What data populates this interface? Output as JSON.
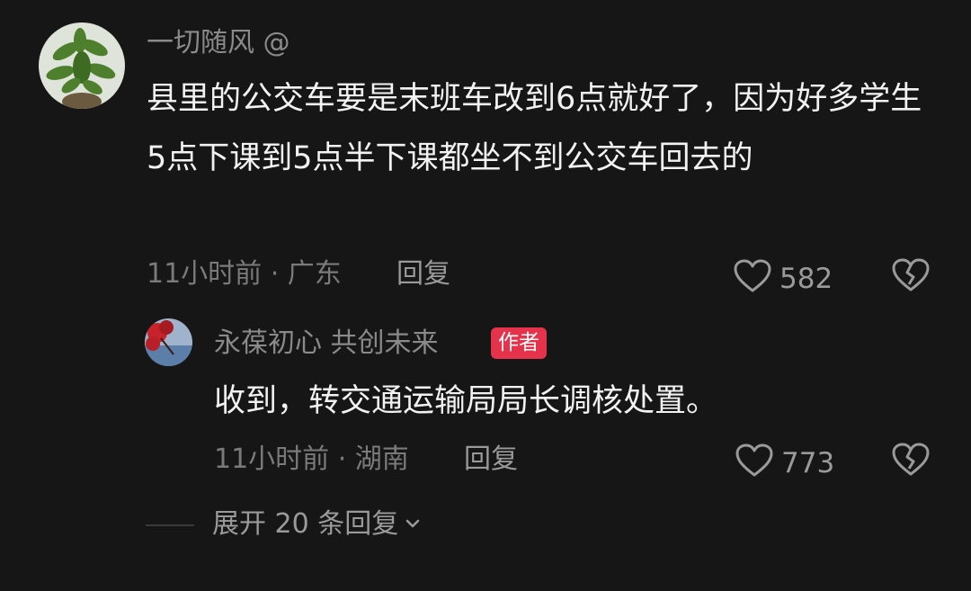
{
  "comment": {
    "username": "一切随风 @",
    "text": "县里的公交车要是末班车改到6点就好了，因为好多学生5点下课到5点半下课都坐不到公交车回去的",
    "meta": "11小时前 · 广东",
    "reply_label": "回复",
    "like_count": "582"
  },
  "reply": {
    "username": "永葆初心  共创未来",
    "author_badge": "作者",
    "text": "收到，转交通运输局局长调核处置。",
    "meta": "11小时前 · 湖南",
    "reply_label": "回复",
    "like_count": "773"
  },
  "expand_label": "展开 20 条回复",
  "icons": {
    "like": "heart-outline-icon",
    "dislike": "broken-heart-icon",
    "expand": "chevron-down-icon"
  },
  "colors": {
    "background": "#161616",
    "badge": "#e5334b"
  }
}
